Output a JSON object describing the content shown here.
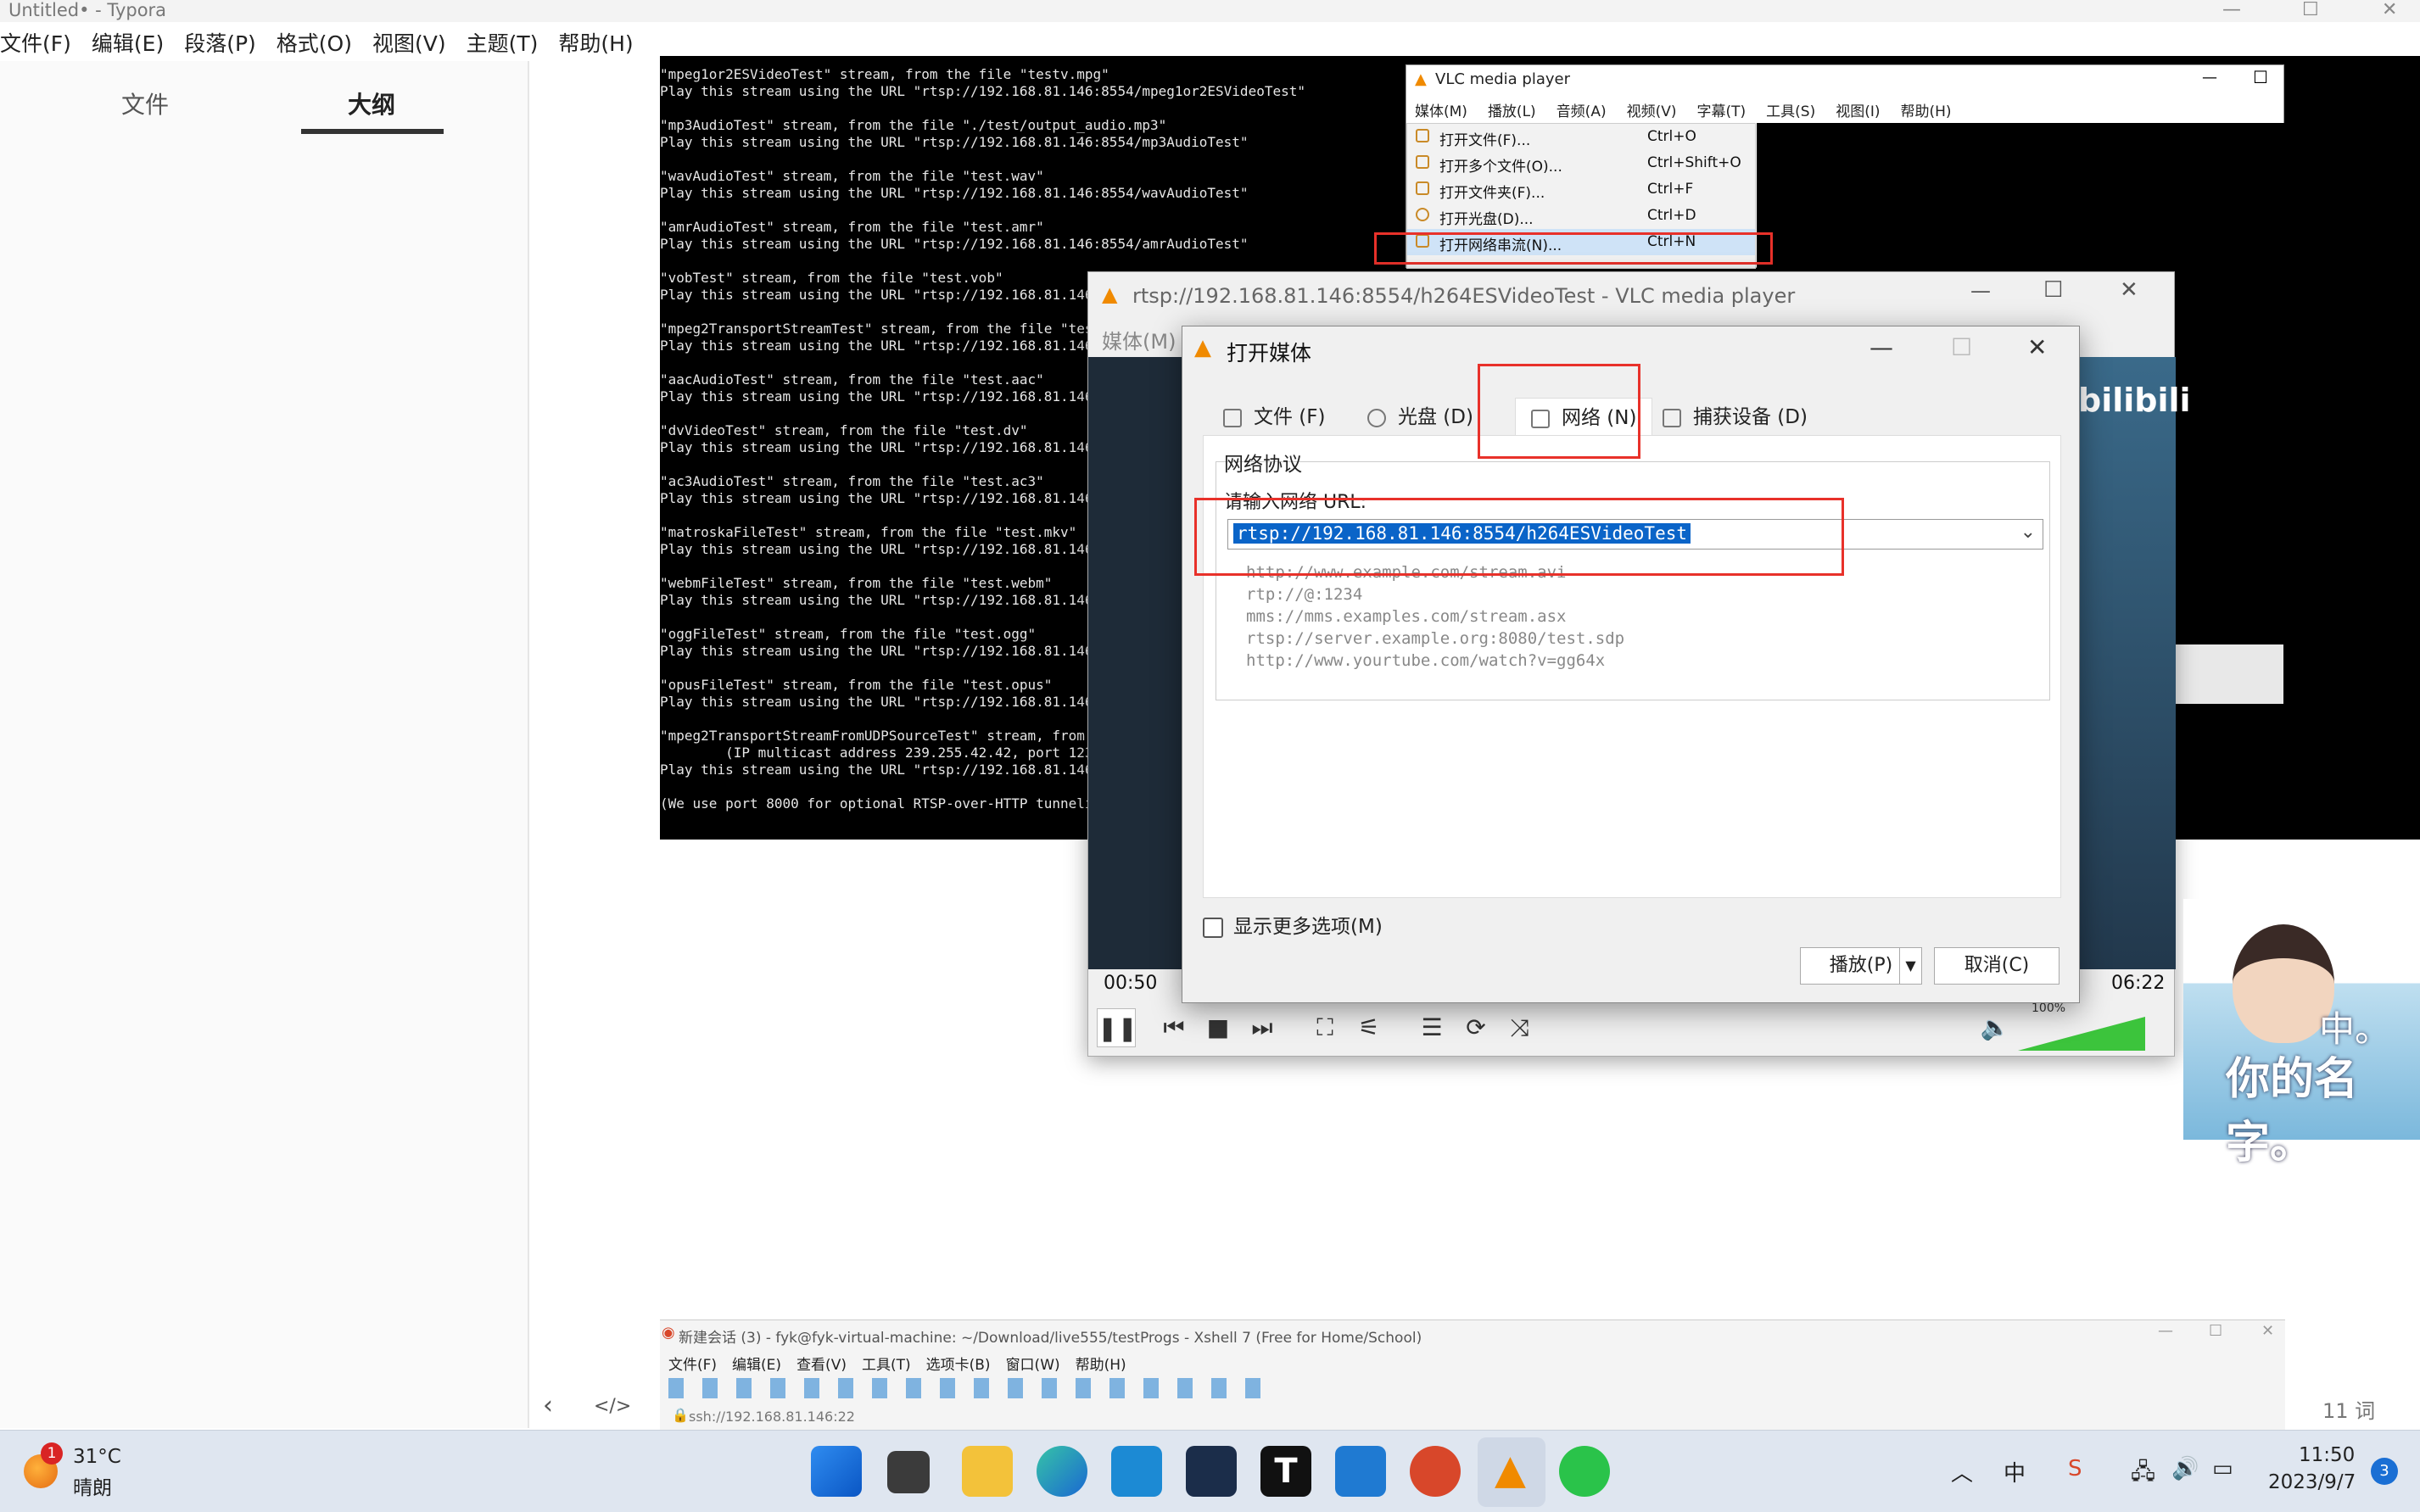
{
  "window": {
    "title": "Untitled• - Typora"
  },
  "menu": [
    "文件(F)",
    "编辑(E)",
    "段落(P)",
    "格式(O)",
    "视图(V)",
    "主题(T)",
    "帮助(H)"
  ],
  "sidebar": {
    "tab_files": "文件",
    "tab_outline": "大纲",
    "word_count": "11 词"
  },
  "terminal": {
    "lines": "\"mpeg1or2ESVideoTest\" stream, from the file \"testv.mpg\"\nPlay this stream using the URL \"rtsp://192.168.81.146:8554/mpeg1or2ESVideoTest\"\n\n\"mp3AudioTest\" stream, from the file \"./test/output_audio.mp3\"\nPlay this stream using the URL \"rtsp://192.168.81.146:8554/mp3AudioTest\"\n\n\"wavAudioTest\" stream, from the file \"test.wav\"\nPlay this stream using the URL \"rtsp://192.168.81.146:8554/wavAudioTest\"\n\n\"amrAudioTest\" stream, from the file \"test.amr\"\nPlay this stream using the URL \"rtsp://192.168.81.146:8554/amrAudioTest\"\n\n\"vobTest\" stream, from the file \"test.vob\"\nPlay this stream using the URL \"rtsp://192.168.81.146\n\n\"mpeg2TransportStreamTest\" stream, from the file \"tes\nPlay this stream using the URL \"rtsp://192.168.81.146\n\n\"aacAudioTest\" stream, from the file \"test.aac\"\nPlay this stream using the URL \"rtsp://192.168.81.146\n\n\"dvVideoTest\" stream, from the file \"test.dv\"\nPlay this stream using the URL \"rtsp://192.168.81.146\n\n\"ac3AudioTest\" stream, from the file \"test.ac3\"\nPlay this stream using the URL \"rtsp://192.168.81.146\n\n\"matroskaFileTest\" stream, from the file \"test.mkv\"\nPlay this stream using the URL \"rtsp://192.168.81.146\n\n\"webmFileTest\" stream, from the file \"test.webm\"\nPlay this stream using the URL \"rtsp://192.168.81.146\n\n\"oggFileTest\" stream, from the file \"test.ogg\"\nPlay this stream using the URL \"rtsp://192.168.81.146\n\n\"opusFileTest\" stream, from the file \"test.opus\"\nPlay this stream using the URL \"rtsp://192.168.81.146\n\n\"mpeg2TransportStreamFromUDPSourceTest\" stream, from\n        (IP multicast address 239.255.42.42, port 123\nPlay this stream using the URL \"rtsp://192.168.81.146\n\n(We use port 8000 for optional RTSP-over-HTTP tunneli"
  },
  "vlc_small": {
    "title": "VLC media player",
    "menu": [
      "媒体(M)",
      "播放(L)",
      "音频(A)",
      "视频(V)",
      "字幕(T)",
      "工具(S)",
      "视图(I)",
      "帮助(H)"
    ],
    "items": [
      {
        "label": "打开文件(F)...",
        "shortcut": "Ctrl+O"
      },
      {
        "label": "打开多个文件(O)...",
        "shortcut": "Ctrl+Shift+O"
      },
      {
        "label": "打开文件夹(F)...",
        "shortcut": "Ctrl+F"
      },
      {
        "label": "打开光盘(D)...",
        "shortcut": "Ctrl+D"
      },
      {
        "label": "打开网络串流(N)...",
        "shortcut": "Ctrl+N"
      }
    ]
  },
  "vlc_big": {
    "title": "rtsp://192.168.81.146:8554/h264ESVideoTest - VLC media player",
    "menu_media": "媒体(M)",
    "time_elapsed": "00:50",
    "time_total": "06:22",
    "volume": "100%",
    "volume_fraction": 1.0
  },
  "dialog": {
    "title": "打开媒体",
    "tabs": [
      "文件 (F)",
      "光盘 (D)",
      "网络 (N)",
      "捕获设备 (D)"
    ],
    "group_title": "网络协议",
    "url_label": "请输入网络 URL:",
    "url_value": "rtsp://192.168.81.146:8554/h264ESVideoTest",
    "examples": "http://www.example.com/stream.avi\nrtp://@:1234\nmms://mms.examples.com/stream.asx\nrtsp://server.example.org:8080/test.sdp\nhttp://www.yourtube.com/watch?v=gg64x",
    "more_options": "显示更多选项(M)",
    "play_button": "播放(P)",
    "cancel_button": "取消(C)"
  },
  "xshell": {
    "title": "新建会话 (3) - fyk@fyk-virtual-machine: ~/Download/live555/testProgs - Xshell 7 (Free for Home/School)",
    "menu": [
      "文件(F)",
      "编辑(E)",
      "查看(V)",
      "工具(T)",
      "选项卡(B)",
      "窗口(W)",
      "帮助(H)"
    ],
    "address": "ssh://192.168.81.146:22"
  },
  "sticker": {
    "text1": "你的名字。",
    "text2": "中。"
  },
  "taskbar": {
    "weather_badge": "1",
    "temperature": "31°C",
    "weather": "晴朗",
    "ime": "中",
    "time": "11:50",
    "date": "2023/9/7",
    "notifications": "3"
  },
  "colors": {
    "highlight_red": "#e8312a",
    "selection_blue": "#0a64c8",
    "vlc_orange": "#f08a00"
  }
}
